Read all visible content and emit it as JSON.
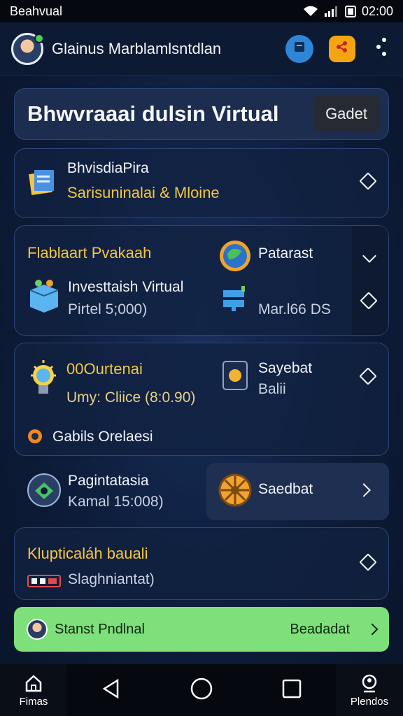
{
  "status": {
    "carrier": "Beahvual",
    "time": "02:00"
  },
  "appbar": {
    "title": "Glainus Marblamlsntdlan",
    "icons": [
      "book-icon",
      "share-icon",
      "kebab-icon"
    ]
  },
  "hero": {
    "title": "Bhwvraaai dulsin Virtual",
    "button": "Gadet"
  },
  "card1": {
    "title": "BhvisdiaPira",
    "subtitle": "Sarisuninalai & Mloine"
  },
  "card2": {
    "heading": "Flablaart Pvakaah",
    "right_label": "Patarast",
    "item_title": "Investtaish Virtual",
    "item_sub": "Pirtel 5;000)",
    "right_sub": "Mar.l66 DS"
  },
  "card3": {
    "heading": "00Ourtenai",
    "sub": "Umy: Cliice (8:0.90)",
    "right_title": "Sayebat",
    "right_sub": "Balii",
    "footer": "Gabils Orelaesi"
  },
  "row4": {
    "title": "Pagintatasia",
    "sub": "Kamal 15:008)",
    "button": "Saedbat"
  },
  "card5": {
    "heading": "Klupticaláh bauali",
    "sub": "Slaghniantat)"
  },
  "cta": {
    "left": "Stanst Pndlnal",
    "right": "Beadadat"
  },
  "nav": {
    "left": "Fimas",
    "right": "Plendos"
  },
  "colors": {
    "accent_yellow": "#f6c63d",
    "cta_green": "#7ee07a",
    "blue_btn": "#2f86d6",
    "orange_btn": "#f3a512"
  }
}
